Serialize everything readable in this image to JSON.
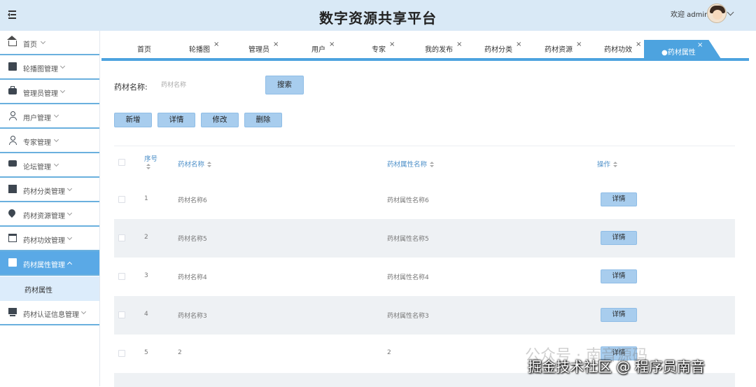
{
  "header": {
    "title": "数字资源共享平台",
    "welcome": "欢迎 admin"
  },
  "sidebar": {
    "items": [
      {
        "label": "首页",
        "icon": "home-icon"
      },
      {
        "label": "轮播图管理",
        "icon": "image-icon"
      },
      {
        "label": "管理员管理",
        "icon": "briefcase-icon"
      },
      {
        "label": "用户管理",
        "icon": "user-icon"
      },
      {
        "label": "专家管理",
        "icon": "user-icon"
      },
      {
        "label": "论坛管理",
        "icon": "chat-icon"
      },
      {
        "label": "药材分类管理",
        "icon": "book-icon"
      },
      {
        "label": "药材资源管理",
        "icon": "drop-icon"
      },
      {
        "label": "药材功效管理",
        "icon": "card-icon"
      },
      {
        "label": "药材属性管理",
        "icon": "panel-icon"
      },
      {
        "label": "药材认证信息管理",
        "icon": "monitor-icon"
      }
    ],
    "sub_item": "药材属性"
  },
  "tabs": [
    {
      "label": "首页"
    },
    {
      "label": "轮播图"
    },
    {
      "label": "管理员"
    },
    {
      "label": "用户"
    },
    {
      "label": "专家"
    },
    {
      "label": "我的发布"
    },
    {
      "label": "药材分类"
    },
    {
      "label": "药材资源"
    },
    {
      "label": "药材功效"
    },
    {
      "label": "●药材属性"
    }
  ],
  "close_glyph": "×",
  "search": {
    "label": "药材名称:",
    "placeholder": "药材名称",
    "button": "搜索"
  },
  "actions": {
    "add": "新增",
    "detail": "详情",
    "edit": "修改",
    "delete": "删除"
  },
  "table": {
    "headers": {
      "index": "序号",
      "name": "药材名称",
      "attr": "药材属性名称",
      "op": "操作"
    },
    "rows": [
      {
        "index": "1",
        "name": "药材名称6",
        "attr": "药材属性名称6",
        "op": "详情"
      },
      {
        "index": "2",
        "name": "药材名称5",
        "attr": "药材属性名称5",
        "op": "详情"
      },
      {
        "index": "3",
        "name": "药材名称4",
        "attr": "药材属性名称4",
        "op": "详情"
      },
      {
        "index": "4",
        "name": "药材名称3",
        "attr": "药材属性名称3",
        "op": "详情"
      },
      {
        "index": "5",
        "name": "2",
        "attr": "2",
        "op": "详情"
      }
    ]
  },
  "overlay": {
    "watermark": "公众号 · 南音源码",
    "credit": "掘金技术社区 @ 程序员南音"
  },
  "colors": {
    "topbar": "#d9e9f6",
    "accent": "#4da3df",
    "active_menu": "#5aa9e6",
    "button": "#a8cdee"
  }
}
